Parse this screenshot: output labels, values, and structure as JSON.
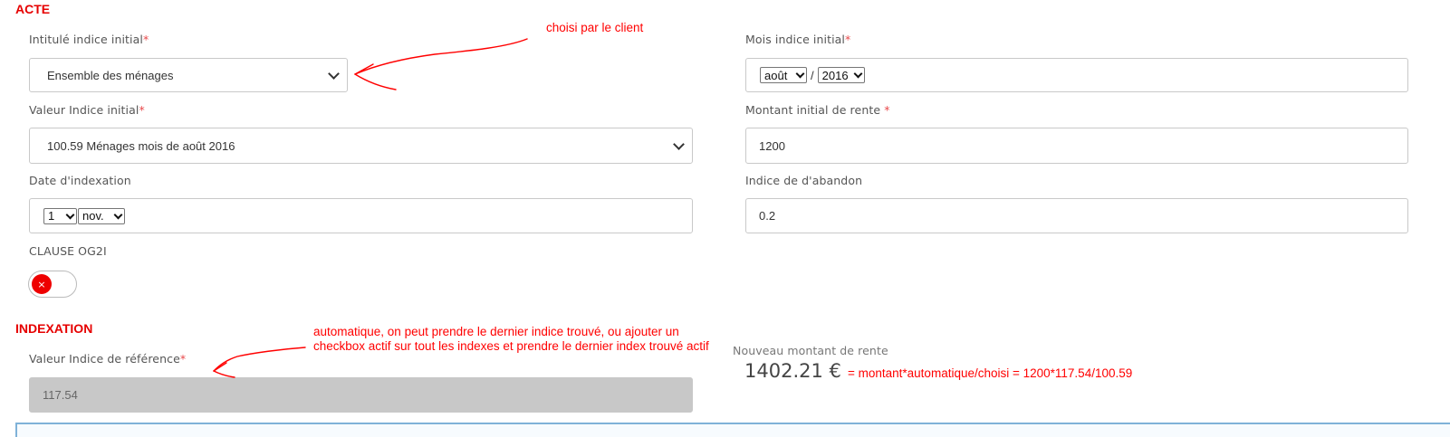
{
  "acte": {
    "title": "ACTE",
    "intitule": {
      "label": "Intitulé indice initial",
      "required": "*",
      "value": "Ensemble des ménages"
    },
    "valeur": {
      "label": "Valeur Indice initial",
      "required": "*",
      "value": "100.59 Ménages mois de août 2016"
    },
    "date_indexation": {
      "label": "Date d'indexation",
      "day": "1",
      "month": "nov."
    },
    "clause": {
      "label": "CLAUSE OG2I",
      "toggle_state": "off",
      "toggle_icon": "×"
    },
    "mois": {
      "label": "Mois indice initial",
      "required": "*",
      "month": "août",
      "separator": "/",
      "year": "2016"
    },
    "montant": {
      "label": "Montant initial de rente",
      "required": " *",
      "value": "1200"
    },
    "abandon": {
      "label": "Indice de d'abandon",
      "value": "0.2"
    }
  },
  "indexation": {
    "title": "INDEXATION",
    "reference": {
      "label": "Valeur Indice de référence",
      "required": "*",
      "value": "117.54"
    },
    "nouveau": {
      "label": "Nouveau montant de rente",
      "amount": "1402.21 €"
    }
  },
  "annotations": {
    "client": "choisi par le client",
    "auto_line1": "automatique, on peut prendre le dernier indice trouvé, ou ajouter un",
    "auto_line2": "checkbox actif sur tout les indexes et prendre le dernier index trouvé actif",
    "formula": "= montant*automatique/choisi = 1200*117.54/100.59"
  },
  "colors": {
    "section_title": "#e60000",
    "annotation": "#ff0000",
    "required_star": "#e8494b",
    "disabled_field": "#c8c8c8",
    "bottom_bar_border": "#7fb2d8"
  }
}
